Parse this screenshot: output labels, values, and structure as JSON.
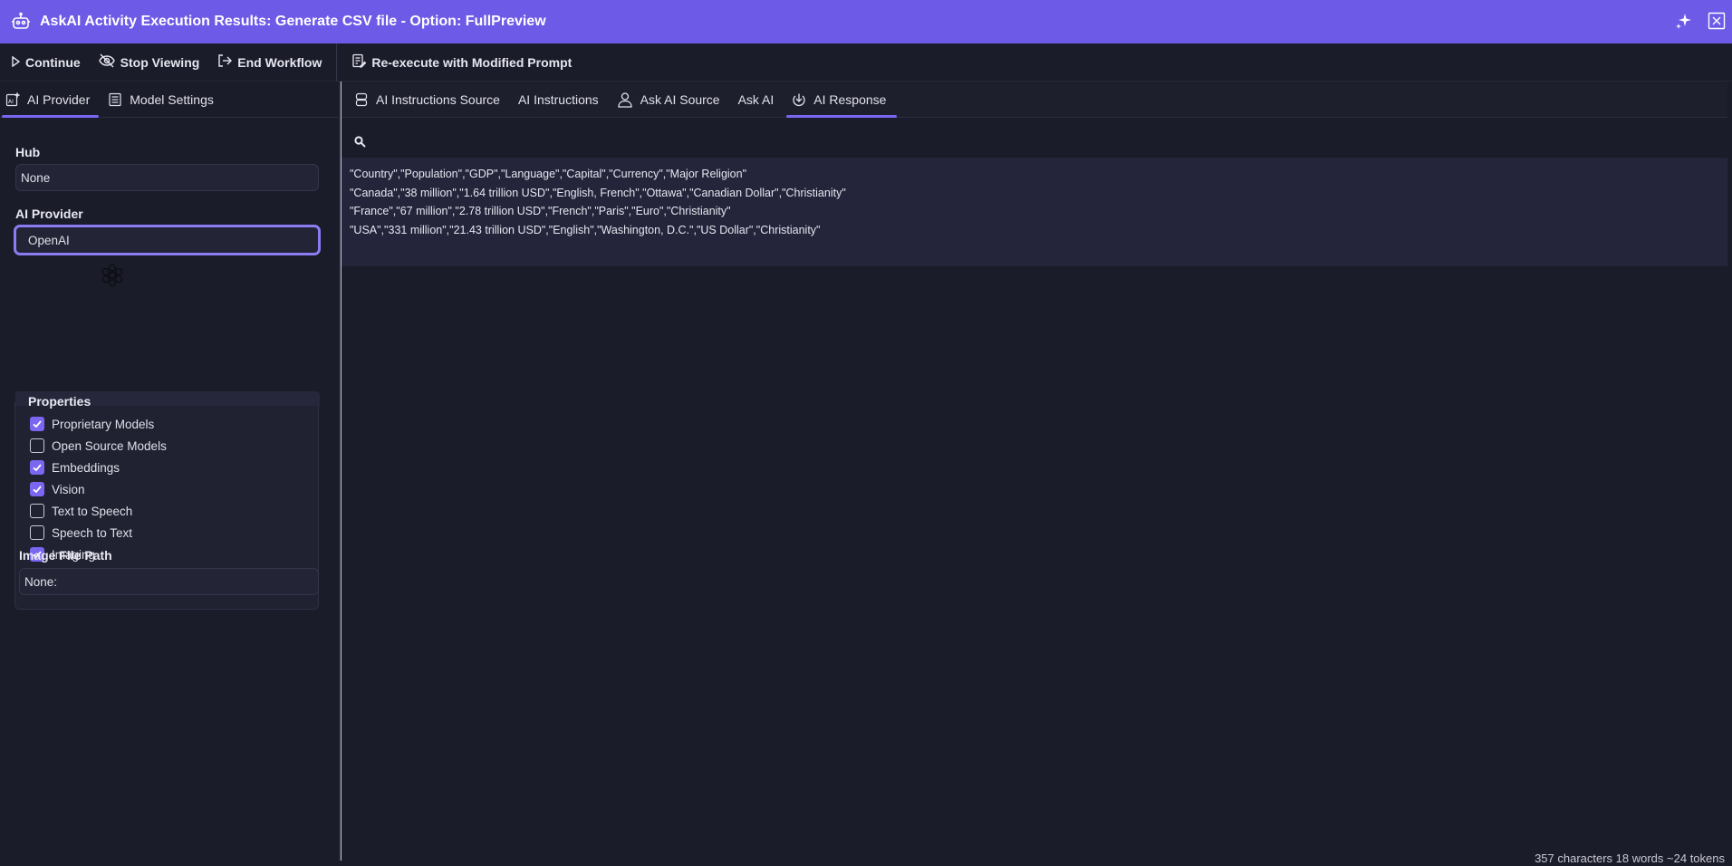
{
  "window": {
    "title": "AskAI Activity Execution Results: Generate CSV file - Option: FullPreview"
  },
  "toolbar": {
    "continue_label": "Continue",
    "stop_viewing_label": "Stop Viewing",
    "end_workflow_label": "End Workflow",
    "reexecute_label": "Re-execute with Modified Prompt"
  },
  "left_tabs": {
    "ai_provider": "AI Provider",
    "model_settings": "Model Settings"
  },
  "hub": {
    "label": "Hub",
    "value": "None"
  },
  "ai_provider": {
    "label": "AI Provider",
    "value": "OpenAI"
  },
  "properties": {
    "title": "Properties",
    "items": [
      {
        "label": "Proprietary Models",
        "checked": true
      },
      {
        "label": "Open Source Models",
        "checked": false
      },
      {
        "label": "Embeddings",
        "checked": true
      },
      {
        "label": "Vision",
        "checked": true
      },
      {
        "label": "Text to Speech",
        "checked": false
      },
      {
        "label": "Speech to Text",
        "checked": false
      },
      {
        "label": "Imaging",
        "checked": true
      }
    ]
  },
  "image_file_path": {
    "label": "Image File Path",
    "value": "None:"
  },
  "right_tabs": {
    "ai_instructions_source": "AI Instructions Source",
    "ai_instructions": "AI Instructions",
    "ask_ai_source": "Ask AI Source",
    "ask_ai": "Ask AI",
    "ai_response": "AI Response"
  },
  "response": {
    "lines": [
      "\"Country\",\"Population\",\"GDP\",\"Language\",\"Capital\",\"Currency\",\"Major Religion\"",
      "\"Canada\",\"38 million\",\"1.64 trillion USD\",\"English, French\",\"Ottawa\",\"Canadian Dollar\",\"Christianity\"",
      "\"France\",\"67 million\",\"2.78 trillion USD\",\"French\",\"Paris\",\"Euro\",\"Christianity\"",
      "\"USA\",\"331 million\",\"21.43 trillion USD\",\"English\",\"Washington, D.C.\",\"US Dollar\",\"Christianity\""
    ]
  },
  "status": {
    "text": "357 characters 18 words ~24 tokens"
  },
  "colors": {
    "accent": "#6d5ae6",
    "background": "#1b1c29",
    "checkbox": "#7a66f0"
  }
}
